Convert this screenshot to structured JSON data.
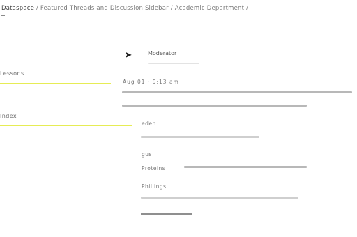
{
  "header": {
    "breadcrumb": "Dataspace",
    "trail": " / Featured Threads and Discussion Sidebar / Academic Department /",
    "dash_char": "—"
  },
  "sidebar": {
    "items": [
      {
        "label": "Lessons",
        "active": true
      },
      {
        "label": "Index",
        "active": true
      }
    ]
  },
  "post": {
    "avatar_glyph": "➤",
    "author": "Moderator",
    "meta": "Aug 01 · 9:13 am"
  },
  "comments": [
    {
      "author": "eden"
    },
    {
      "author": "gus",
      "label": "Proteins"
    },
    {
      "author": "Phillings"
    }
  ],
  "colors": {
    "highlight": "#e6ec55",
    "text_dark": "#3a3a3a",
    "placeholder": "#c4c4c4"
  }
}
